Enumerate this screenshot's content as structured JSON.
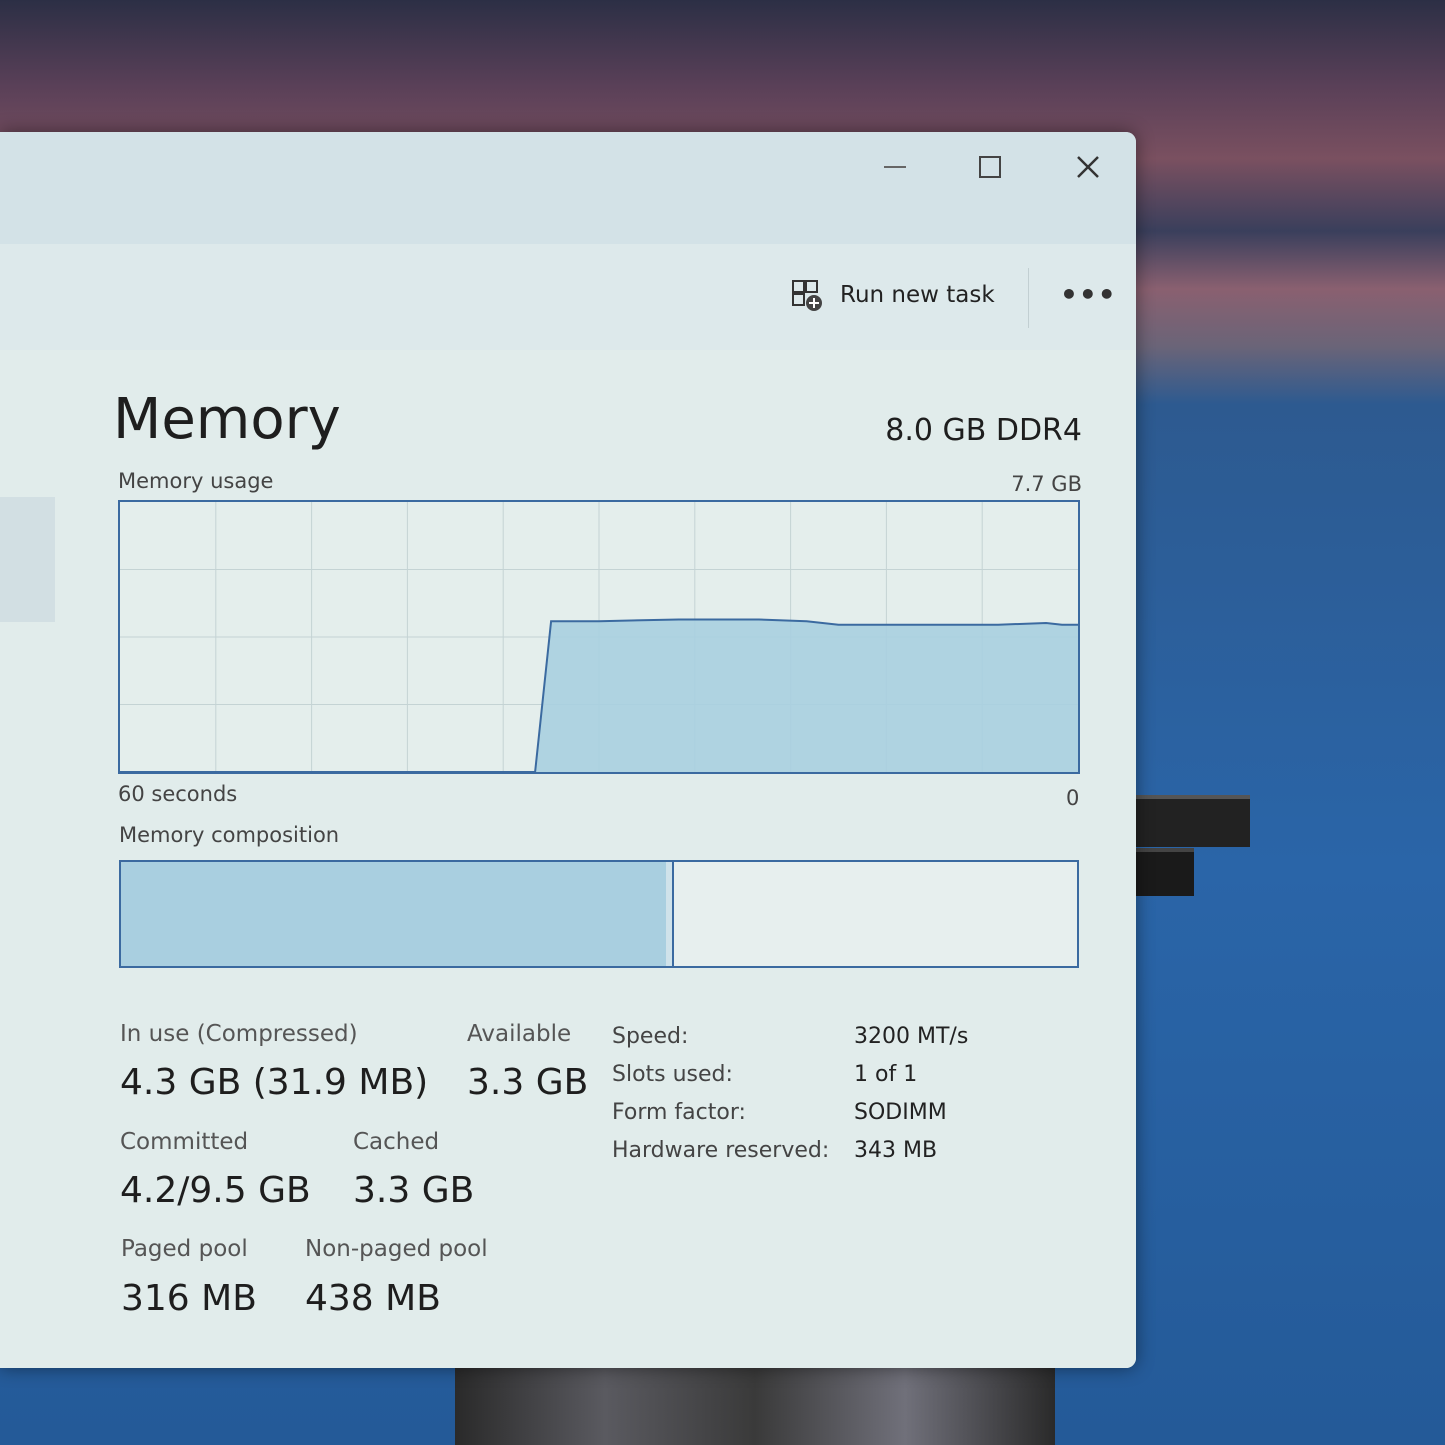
{
  "window": {
    "controls": {
      "minimize": "minimize",
      "maximize": "maximize",
      "close": "close"
    }
  },
  "toolbar": {
    "run_new_task": "Run new task",
    "more": "•••"
  },
  "memory": {
    "title": "Memory",
    "spec": "8.0 GB DDR4",
    "usage_label": "Memory usage",
    "usage_max": "7.7 GB",
    "time_left": "60 seconds",
    "time_right": "0",
    "composition_label": "Memory composition",
    "composition": {
      "in_use_fraction": 0.57,
      "modified_fraction": 0.006
    }
  },
  "chart_data": {
    "type": "area",
    "title": "",
    "xlabel": "",
    "ylabel": "",
    "x": [
      60,
      34,
      33,
      30,
      25,
      20,
      17,
      15,
      10,
      5,
      2,
      1,
      0
    ],
    "xlim": [
      60,
      0
    ],
    "ylim": [
      0,
      7.7
    ],
    "grid": true,
    "series": [
      {
        "values": [
          0,
          0,
          4.3,
          4.3,
          4.35,
          4.35,
          4.3,
          4.2,
          4.2,
          4.2,
          4.25,
          4.2,
          4.2
        ]
      }
    ]
  },
  "stats": {
    "in_use": {
      "label": "In use (Compressed)",
      "value": "4.3 GB (31.9 MB)"
    },
    "available": {
      "label": "Available",
      "value": "3.3 GB"
    },
    "committed": {
      "label": "Committed",
      "value": "4.2/9.5 GB"
    },
    "cached": {
      "label": "Cached",
      "value": "3.3 GB"
    },
    "paged_pool": {
      "label": "Paged pool",
      "value": "316 MB"
    },
    "non_paged_pool": {
      "label": "Non-paged pool",
      "value": "438 MB"
    }
  },
  "details": [
    {
      "label": "Speed:",
      "value": "3200 MT/s"
    },
    {
      "label": "Slots used:",
      "value": "1 of 1"
    },
    {
      "label": "Form factor:",
      "value": "SODIMM"
    },
    {
      "label": "Hardware reserved:",
      "value": "343 MB"
    }
  ],
  "colors": {
    "accent": "#3b6aa0",
    "fill": "#a9cfe0",
    "grid": "#c4d3d4"
  },
  "icons": {
    "run_task": "run-task-icon",
    "close": "close-icon"
  }
}
